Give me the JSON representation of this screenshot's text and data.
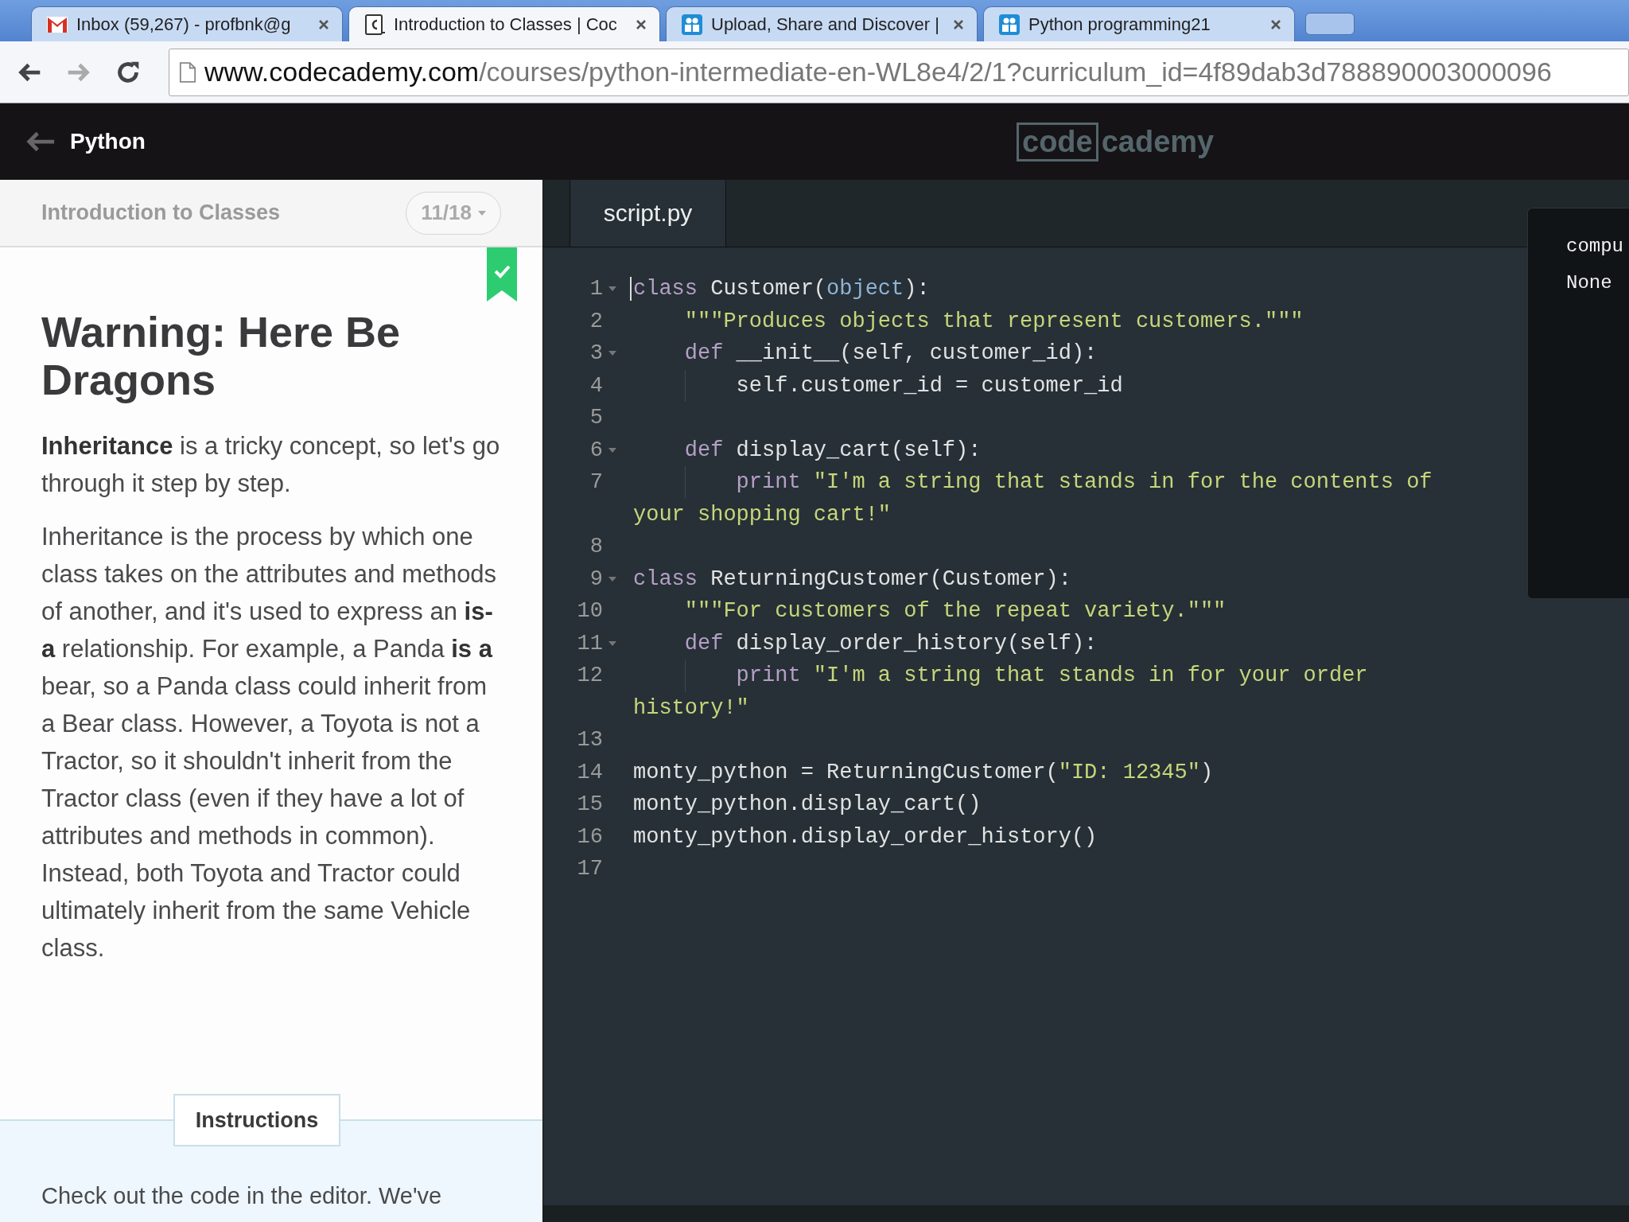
{
  "browser": {
    "tabs": [
      {
        "kind": "mail",
        "title": "Inbox (59,267) - profbnk@g",
        "selected": false
      },
      {
        "kind": "code",
        "title": "Introduction to Classes | Coc",
        "selected": true
      },
      {
        "kind": "share",
        "title": "Upload, Share and Discover |",
        "selected": false
      },
      {
        "kind": "share",
        "title": "Python programming21",
        "selected": false
      }
    ],
    "address": {
      "host": "www.codecademy.com",
      "path": "/courses/python-intermediate-en-WL8e4/2/1?curriculum_id=4f89dab3d788890003000096"
    }
  },
  "header": {
    "course": "Python",
    "logo": {
      "boxed": "code",
      "rest": "cademy"
    }
  },
  "lesson": {
    "unit": "Introduction to Classes",
    "progress": "11/18",
    "completed": true,
    "title": "Warning: Here Be Dragons",
    "paragraphs": [
      "**Inheritance** is a tricky concept, so let's go through it step by step.",
      "Inheritance is the process by which one class takes on the attributes and methods of another, and it's used to express an **is-a** relationship. For example, a Panda **is a** bear, so a Panda class could inherit from a Bear class. However, a Toyota is not a Tractor, so it shouldn't inherit from the Tractor class (even if they have a lot of attributes and methods in common). Instead, both Toyota and Tractor could ultimately inherit from the same Vehicle class."
    ],
    "instructions_button": "Instructions",
    "instructions": "Check out the code in the editor. We've"
  },
  "editor": {
    "file_tab": "script.py",
    "lines": [
      {
        "number": "1",
        "fold": true,
        "guide": false,
        "cursor": true,
        "tokens": [
          {
            "text": "class",
            "kind": "keyword"
          },
          {
            "text": " Customer(",
            "kind": "plain"
          },
          {
            "text": "object",
            "kind": "builtin"
          },
          {
            "text": "):",
            "kind": "plain"
          }
        ]
      },
      {
        "number": "2",
        "fold": false,
        "guide": false,
        "cursor": false,
        "tokens": [
          {
            "text": "    \"\"\"Produces objects that represent customers.\"\"\"",
            "kind": "string"
          }
        ]
      },
      {
        "number": "3",
        "fold": true,
        "guide": false,
        "cursor": false,
        "tokens": [
          {
            "text": "    def",
            "kind": "keyword"
          },
          {
            "text": " __init__(self, customer_id):",
            "kind": "plain"
          }
        ]
      },
      {
        "number": "4",
        "fold": false,
        "guide": true,
        "cursor": false,
        "tokens": [
          {
            "text": "        self.customer_id = customer_id",
            "kind": "plain"
          }
        ]
      },
      {
        "number": "5",
        "fold": false,
        "guide": false,
        "cursor": false
      },
      {
        "number": "6",
        "fold": true,
        "guide": false,
        "cursor": false,
        "tokens": [
          {
            "text": "    def",
            "kind": "keyword"
          },
          {
            "text": " display_cart(self):",
            "kind": "plain"
          }
        ]
      },
      {
        "number": "7",
        "fold": false,
        "guide": true,
        "cursor": false,
        "tokens": [
          {
            "text": "        print",
            "kind": "keyword"
          },
          {
            "text": " \"I'm a string that stands in for the contents of",
            "kind": "string"
          }
        ],
        "wrap": [
          {
            "text": "your shopping cart!\"",
            "kind": "string"
          }
        ]
      },
      {
        "number": "8",
        "fold": false,
        "guide": false,
        "cursor": false
      },
      {
        "number": "9",
        "fold": true,
        "guide": false,
        "cursor": false,
        "tokens": [
          {
            "text": "class",
            "kind": "keyword"
          },
          {
            "text": " ReturningCustomer(Customer):",
            "kind": "plain"
          }
        ]
      },
      {
        "number": "10",
        "fold": false,
        "guide": false,
        "cursor": false,
        "tokens": [
          {
            "text": "    \"\"\"For customers of the repeat variety.\"\"\"",
            "kind": "string"
          }
        ]
      },
      {
        "number": "11",
        "fold": true,
        "guide": false,
        "cursor": false,
        "tokens": [
          {
            "text": "    def",
            "kind": "keyword"
          },
          {
            "text": " display_order_history(self):",
            "kind": "plain"
          }
        ]
      },
      {
        "number": "12",
        "fold": false,
        "guide": true,
        "cursor": false,
        "tokens": [
          {
            "text": "        print",
            "kind": "keyword"
          },
          {
            "text": " \"I'm a string that stands in for your order",
            "kind": "string"
          }
        ],
        "wrap": [
          {
            "text": "history!\"",
            "kind": "string"
          }
        ]
      },
      {
        "number": "13",
        "fold": false,
        "guide": false,
        "cursor": false
      },
      {
        "number": "14",
        "fold": false,
        "guide": false,
        "cursor": false,
        "tokens": [
          {
            "text": "monty_python = ReturningCustomer(",
            "kind": "plain"
          },
          {
            "text": "\"ID: 12345\"",
            "kind": "string"
          },
          {
            "text": ")",
            "kind": "plain"
          }
        ]
      },
      {
        "number": "15",
        "fold": false,
        "guide": false,
        "cursor": false,
        "tokens": [
          {
            "text": "monty_python.display_cart()",
            "kind": "plain"
          }
        ]
      },
      {
        "number": "16",
        "fold": false,
        "guide": false,
        "cursor": false,
        "tokens": [
          {
            "text": "monty_python.display_order_history()",
            "kind": "plain"
          }
        ]
      },
      {
        "number": "17",
        "fold": false,
        "guide": false,
        "cursor": false
      }
    ]
  },
  "output": {
    "lines": [
      "compu",
      "None"
    ]
  }
}
